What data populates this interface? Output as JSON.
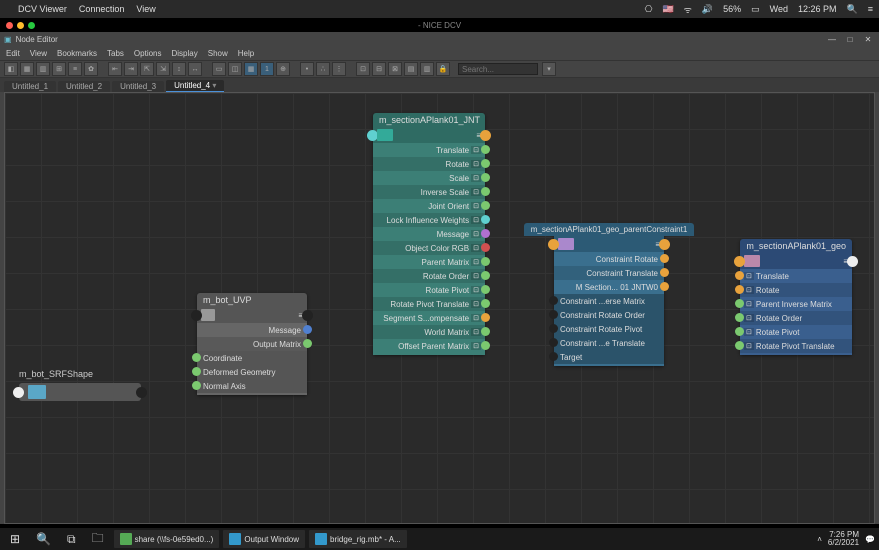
{
  "mac": {
    "app": "DCV Viewer",
    "menus": [
      "Connection",
      "View"
    ],
    "right": {
      "wifi": "⏚",
      "flag": "🇺🇸",
      "vol": "🔊",
      "pct": "56%",
      "batt": "🔋",
      "day": "Wed",
      "time": "12:26 PM"
    }
  },
  "dcv_title": "- NICE DCV",
  "window": {
    "title": "Node Editor"
  },
  "menus": [
    "Edit",
    "View",
    "Bookmarks",
    "Tabs",
    "Options",
    "Display",
    "Show",
    "Help"
  ],
  "search_placeholder": "Search...",
  "tabs": [
    "Untitled_1",
    "Untitled_2",
    "Untitled_3",
    "Untitled_4"
  ],
  "active_tab": 3,
  "nodes": {
    "srf": {
      "title": "m_bot_SRFShape"
    },
    "uvp": {
      "title": "m_bot_UVP",
      "outputs": [
        "Message",
        "Output Matrix"
      ],
      "inputs": [
        "Coordinate",
        "Deformed Geometry",
        "Normal Axis"
      ]
    },
    "jnt": {
      "title": "m_sectionAPlank01_JNT",
      "attrs": [
        "Translate",
        "Rotate",
        "Scale",
        "Inverse Scale",
        "Joint Orient",
        "Lock Influence Weights",
        "Message",
        "Object Color RGB",
        "Parent Matrix",
        "Rotate Order",
        "Rotate Pivot",
        "Rotate Pivot Translate",
        "Segment S...ompensate",
        "World Matrix",
        "Offset Parent Matrix"
      ]
    },
    "pc": {
      "title": "m_sectionAPlank01_geo_parentConstraint1",
      "attrs": [
        "Constraint Rotate",
        "Constraint Translate",
        "M Section... 01 JNTW0",
        "Constraint ...erse Matrix",
        "Constraint Rotate Order",
        "Constraint Rotate Pivot",
        "Constraint ...e Translate",
        "Target"
      ]
    },
    "geo": {
      "title": "m_sectionAPlank01_geo",
      "attrs": [
        "Translate",
        "Rotate",
        "Parent Inverse Matrix",
        "Rotate Order",
        "Rotate Pivot",
        "Rotate Pivot Translate"
      ]
    }
  },
  "pin_colors": {
    "orange": "#e8a23c",
    "green": "#7bc96f",
    "white": "#e8e8e8",
    "black": "#1a1a1a",
    "cyan": "#5fd0d0",
    "purple": "#b070d0",
    "red": "#d05050",
    "blue": "#5080d0"
  },
  "taskbar": {
    "items": [
      {
        "label": "share (\\\\fs-0e59ed0...)",
        "color": "green"
      },
      {
        "label": "Output Window",
        "color": "blue"
      },
      {
        "label": "bridge_rig.mb* - A...",
        "color": "blue"
      }
    ],
    "time": "7:26 PM",
    "date": "6/2/2021"
  }
}
